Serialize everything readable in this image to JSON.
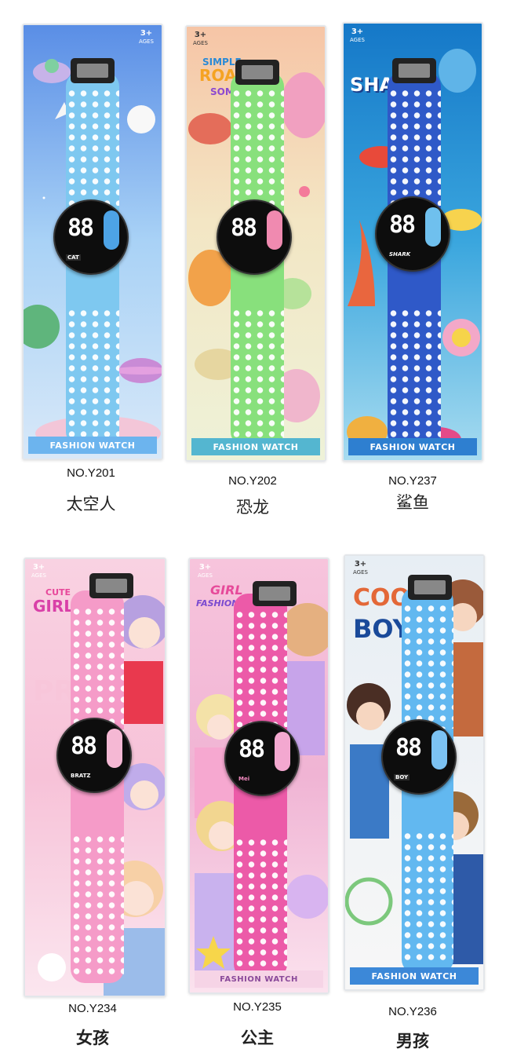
{
  "products": [
    {
      "model": "NO.Y201",
      "name": "太空人",
      "banner": "FASHION WATCH",
      "age": "3+",
      "age_sub": "AGES",
      "strap_color": "#7ec8f0",
      "bg_colors": [
        "#6ea8ec",
        "#b7d8f8"
      ],
      "banner_color": "#6cb4ee",
      "pill_color": "#4da3e6",
      "face_logo": "CAT",
      "icon": "astronaut-icon"
    },
    {
      "model": "NO.Y202",
      "name": "恐龙",
      "banner": "FASHION WATCH",
      "age": "3+",
      "age_sub": "AGES",
      "strap_color": "#88e07c",
      "bg_colors": [
        "#f5c9a4",
        "#ecf2d0"
      ],
      "banner_color": "#54b6d0",
      "pill_color": "#f08ab0",
      "title_line1": "SIMPLE",
      "title_line2": "ROAR",
      "title_line3": "SOME",
      "icon": "dinosaur-icon"
    },
    {
      "model": "NO.Y237",
      "name": "鲨鱼",
      "banner": "FASHION WATCH",
      "age": "3+",
      "age_sub": "AGES",
      "strap_color": "#2f59c8",
      "bg_colors": [
        "#1b8bd6",
        "#6cc7e8"
      ],
      "banner_color": "#2e7fd0",
      "pill_color": "#6fc0ee",
      "title_line1": "SHARK",
      "face_logo": "SHARK",
      "icon": "shark-icon"
    },
    {
      "model": "NO.Y234",
      "name": "女孩",
      "banner": "",
      "age": "3+",
      "age_sub": "AGES",
      "strap_color": "#f59bc8",
      "bg_colors": [
        "#f7c8dc",
        "#fde8ef"
      ],
      "banner_color": "#f2a6c8",
      "pill_color": "#f5b8d4",
      "title_line1": "CUTE",
      "title_line2": "GIRL",
      "face_logo": "BRATZ",
      "icon": "anime-girl-icon"
    },
    {
      "model": "NO.Y235",
      "name": "公主",
      "banner": "FASHION WATCH",
      "age": "3+",
      "age_sub": "AGES",
      "strap_color": "#ec5aa8",
      "bg_colors": [
        "#f4b8d8",
        "#fbe4ef"
      ],
      "banner_color": "#f6d4e6",
      "pill_color": "#f3a8d0",
      "title_line1": "GIRL",
      "title_line2": "FASHIONABLE",
      "face_logo": "Mei",
      "icon": "princess-icon"
    },
    {
      "model": "NO.Y236",
      "name": "男孩",
      "banner": "FASHION WATCH",
      "age": "3+",
      "age_sub": "AGES",
      "strap_color": "#62b8f0",
      "bg_colors": [
        "#dfe8f0",
        "#f6f7f8"
      ],
      "banner_color": "#3c88d8",
      "pill_color": "#7cc2f2",
      "title_line1": "COOL",
      "title_line2": "BOY",
      "face_logo": "BOY",
      "icon": "anime-boy-icon"
    }
  ],
  "watch_display": "88"
}
